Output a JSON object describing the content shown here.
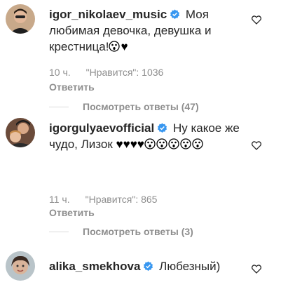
{
  "comments": [
    {
      "username": "igor_nikolaev_music",
      "text_before": "Моя любимая девочка, девушка и крестница!",
      "time": "10 ч.",
      "likes": "\"Нравится\": 1036",
      "reply_label": "Ответить",
      "view_replies": "Посмотреть ответы (47)"
    },
    {
      "username": "igorgulyaevofficial",
      "text_before": "Ну какое же чудо, Лизок",
      "time": "11 ч.",
      "likes": "\"Нравится\": 865",
      "reply_label": "Ответить",
      "view_replies": "Посмотреть ответы (3)"
    },
    {
      "username": "alika_smekhova",
      "text_before": "Любезный)"
    }
  ],
  "colors": {
    "verified": "#3897f0",
    "muted": "#8e8e8e",
    "text": "#262626",
    "divider": "#dbdbdb"
  },
  "icons": {
    "verified": "verified-badge-icon",
    "like": "heart-outline-icon",
    "emoji": "astonished-face-emoji",
    "black_heart": "black-heart-emoji"
  }
}
